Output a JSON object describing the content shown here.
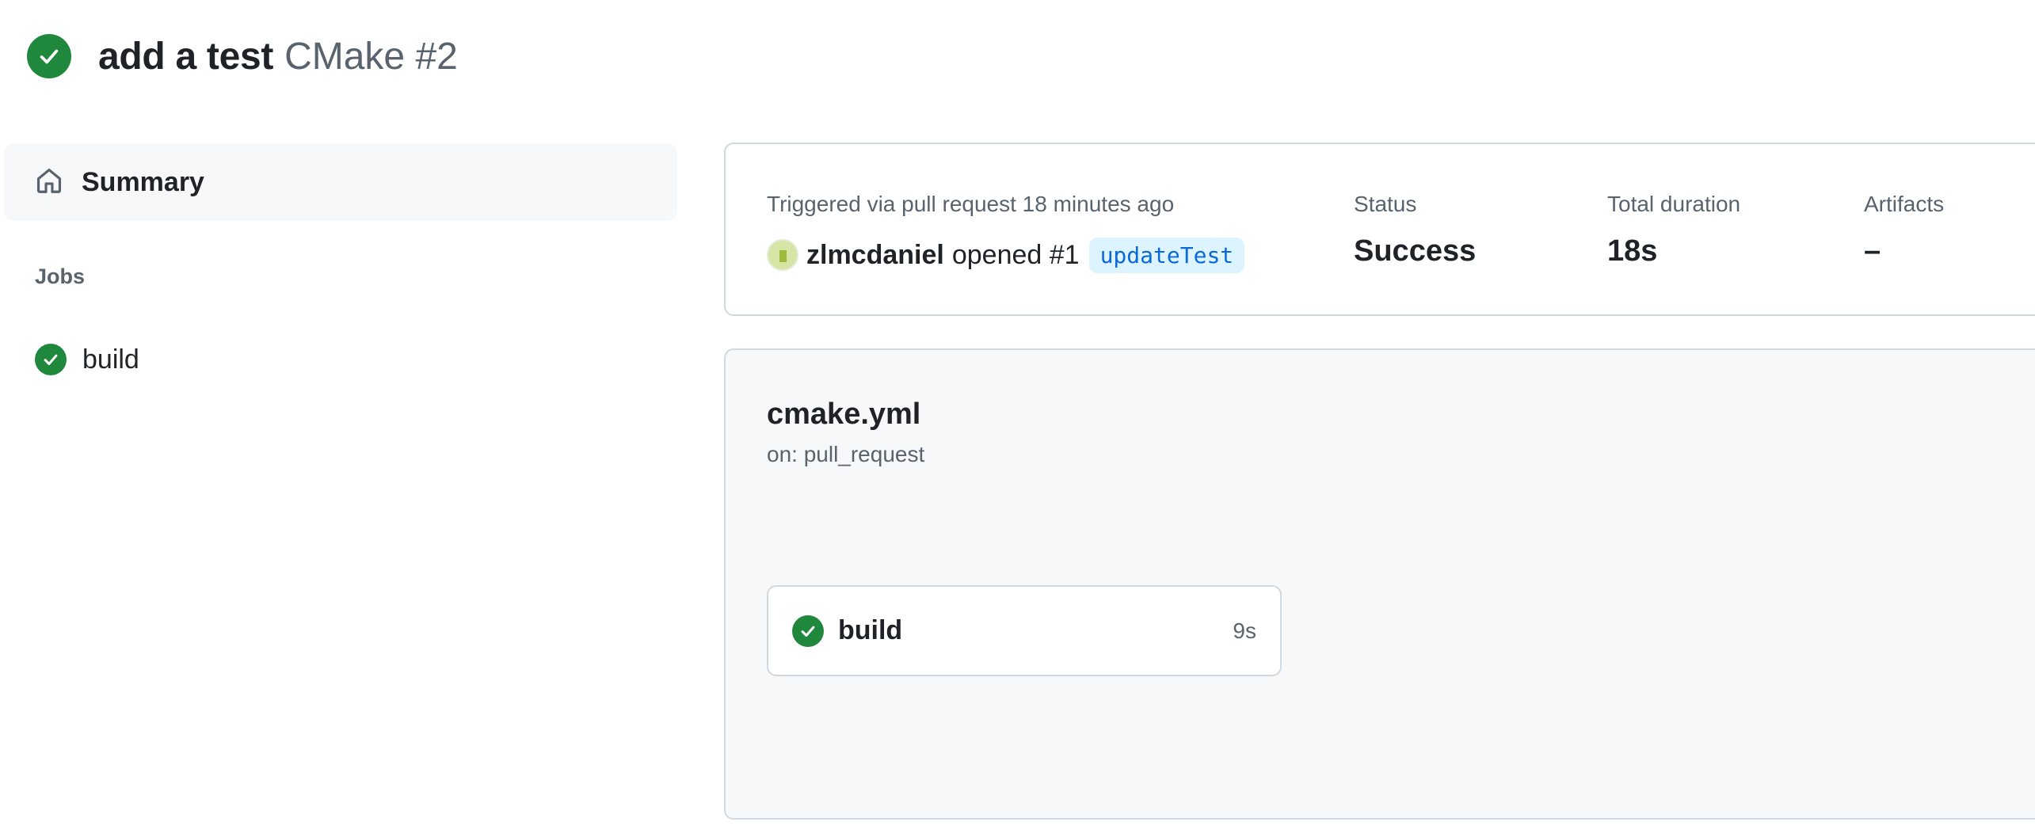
{
  "header": {
    "title": "add a test",
    "subtitle": "CMake #2",
    "status_icon": "check-circle-fill-icon"
  },
  "sidebar": {
    "summary": {
      "label": "Summary",
      "icon": "home-icon"
    },
    "jobs_heading": "Jobs",
    "jobs": [
      {
        "label": "build",
        "status": "success",
        "icon": "check-circle-fill-icon"
      }
    ]
  },
  "summary": {
    "trigger_label": "Triggered via pull request 18 minutes ago",
    "author": "zlmcdaniel",
    "action": "opened #1",
    "branch": "updateTest",
    "status_label": "Status",
    "status_value": "Success",
    "duration_label": "Total duration",
    "duration_value": "18s",
    "artifacts_label": "Artifacts",
    "artifacts_value": "–"
  },
  "workflow": {
    "name": "cmake.yml",
    "trigger": "on: pull_request",
    "jobs": [
      {
        "name": "build",
        "duration": "9s",
        "status": "success"
      }
    ]
  },
  "colors": {
    "success": "#1f883d",
    "muted_text": "#59636e",
    "text": "#1f2328",
    "branch_bg": "#ddf4ff",
    "branch_fg": "#0969da",
    "border": "#d1d9e0",
    "panel_bg": "#f6f8fa"
  }
}
